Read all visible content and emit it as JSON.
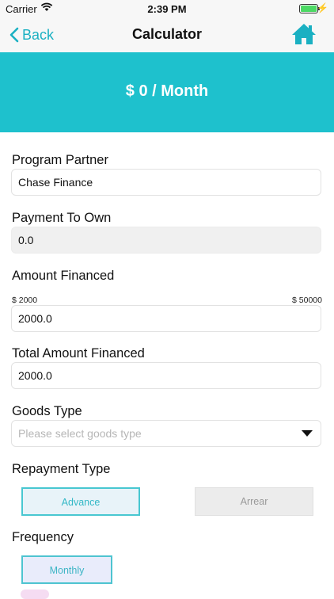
{
  "status_bar": {
    "carrier": "Carrier",
    "time": "2:39 PM"
  },
  "nav": {
    "back_label": "Back",
    "title": "Calculator"
  },
  "banner": {
    "text": "$ 0 / Month"
  },
  "form": {
    "program_partner": {
      "label": "Program Partner",
      "value": "Chase Finance"
    },
    "payment_to_own": {
      "label": "Payment To Own",
      "value": "0.0"
    },
    "amount_financed": {
      "label": "Amount Financed",
      "min_label": "$ 2000",
      "max_label": "$ 50000",
      "value": "2000.0"
    },
    "total_amount_financed": {
      "label": "Total Amount Financed",
      "value": "2000.0"
    },
    "goods_type": {
      "label": "Goods Type",
      "placeholder": "Please select goods type"
    },
    "repayment_type": {
      "label": "Repayment Type",
      "options": [
        "Advance",
        "Arrear"
      ],
      "selected": "Advance"
    },
    "frequency": {
      "label": "Frequency",
      "options": [
        "Monthly"
      ],
      "selected": "Monthly"
    }
  },
  "colors": {
    "accent": "#1ec1cd",
    "back_link": "#1ab0c2"
  },
  "icons": {
    "back": "chevron-left-icon",
    "home": "home-icon",
    "wifi": "wifi-icon",
    "battery": "battery-icon",
    "dropdown": "caret-down-icon"
  }
}
